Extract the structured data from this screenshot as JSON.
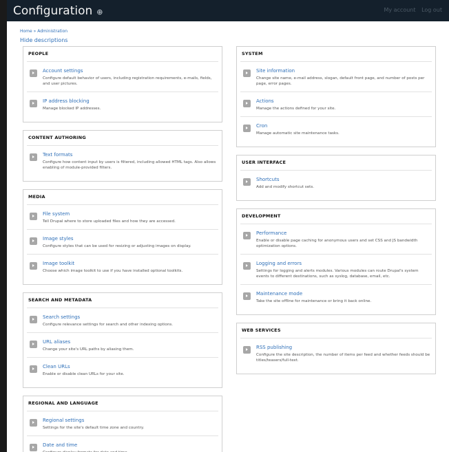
{
  "header": {
    "title": "Configuration",
    "star_glyph": "⊕",
    "user_links": [
      "My account",
      "Log out"
    ]
  },
  "breadcrumb": "Home » Administration",
  "hide_descriptions": "Hide descriptions",
  "left_panels": [
    {
      "heading": "PEOPLE",
      "items": [
        {
          "title": "Account settings",
          "desc": "Configure default behavior of users, including registration requirements, e-mails, fields, and user pictures."
        },
        {
          "title": "IP address blocking",
          "desc": "Manage blocked IP addresses."
        }
      ]
    },
    {
      "heading": "CONTENT AUTHORING",
      "items": [
        {
          "title": "Text formats",
          "desc": "Configure how content input by users is filtered, including allowed HTML tags. Also allows enabling of module-provided filters."
        }
      ]
    },
    {
      "heading": "MEDIA",
      "items": [
        {
          "title": "File system",
          "desc": "Tell Drupal where to store uploaded files and how they are accessed."
        },
        {
          "title": "Image styles",
          "desc": "Configure styles that can be used for resizing or adjusting images on display."
        },
        {
          "title": "Image toolkit",
          "desc": "Choose which image toolkit to use if you have installed optional toolkits."
        }
      ]
    },
    {
      "heading": "SEARCH AND METADATA",
      "items": [
        {
          "title": "Search settings",
          "desc": "Configure relevance settings for search and other indexing options."
        },
        {
          "title": "URL aliases",
          "desc": "Change your site's URL paths by aliasing them."
        },
        {
          "title": "Clean URLs",
          "desc": "Enable or disable clean URLs for your site."
        }
      ]
    },
    {
      "heading": "REGIONAL AND LANGUAGE",
      "items": [
        {
          "title": "Regional settings",
          "desc": "Settings for the site's default time zone and country."
        },
        {
          "title": "Date and time",
          "desc": "Configure display formats for date and time."
        }
      ]
    }
  ],
  "right_panels": [
    {
      "heading": "SYSTEM",
      "items": [
        {
          "title": "Site information",
          "desc": "Change site name, e-mail address, slogan, default front page, and number of posts per page, error pages."
        },
        {
          "title": "Actions",
          "desc": "Manage the actions defined for your site."
        },
        {
          "title": "Cron",
          "desc": "Manage automatic site maintenance tasks."
        }
      ]
    },
    {
      "heading": "USER INTERFACE",
      "items": [
        {
          "title": "Shortcuts",
          "desc": "Add and modify shortcut sets."
        }
      ]
    },
    {
      "heading": "DEVELOPMENT",
      "items": [
        {
          "title": "Performance",
          "desc": "Enable or disable page caching for anonymous users and set CSS and JS bandwidth optimization options."
        },
        {
          "title": "Logging and errors",
          "desc": "Settings for logging and alerts modules. Various modules can route Drupal's system events to different destinations, such as syslog, database, email, etc."
        },
        {
          "title": "Maintenance mode",
          "desc": "Take the site offline for maintenance or bring it back online."
        }
      ]
    },
    {
      "heading": "WEB SERVICES",
      "items": [
        {
          "title": "RSS publishing",
          "desc": "Configure the site description, the number of items per feed and whether feeds should be titles/teasers/full-text."
        }
      ]
    }
  ]
}
